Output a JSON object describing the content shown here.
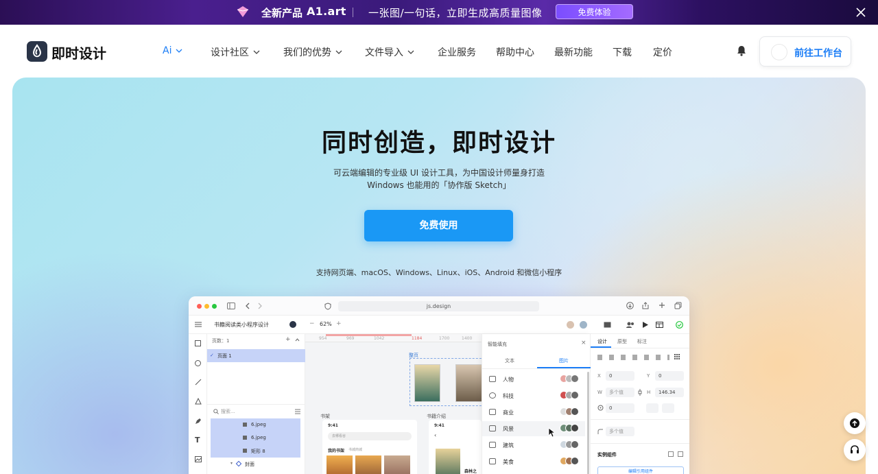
{
  "promo": {
    "product_label": "全新产品",
    "product_name": "A1.art",
    "tagline": "一张图/一句话，立即生成高质量图像",
    "cta": "免费体验"
  },
  "header": {
    "brand": "即时设计",
    "nav": [
      {
        "label": "Ai",
        "dropdown": true
      },
      {
        "label": "设计社区",
        "dropdown": true
      },
      {
        "label": "我们的优势",
        "dropdown": true
      },
      {
        "label": "文件导入",
        "dropdown": true
      },
      {
        "label": "企业服务",
        "dropdown": false
      },
      {
        "label": "帮助中心",
        "dropdown": false
      },
      {
        "label": "最新功能",
        "dropdown": false
      },
      {
        "label": "下载",
        "dropdown": false
      },
      {
        "label": "定价",
        "dropdown": false
      }
    ],
    "workspace_button": "前往工作台"
  },
  "hero": {
    "title": "同时创造，即时设计",
    "subtitle_line1": "可云端编辑的专业级 UI 设计工具，为中国设计师量身打造",
    "subtitle_line2": "Windows 也能用的「协作版 Sketch」",
    "cta": "免费使用",
    "platforms": "支持网页端、macOS、Windows、Linux、iOS、Android 和微信小程序"
  },
  "app": {
    "url": "js.design",
    "file_name": "书籍阅读类小程序设计",
    "zoom": "62%",
    "pages_header": "页数：1",
    "page_item": "页面 1",
    "search_placeholder": "搜索...",
    "layers": [
      "6.jpeg",
      "6.jpeg",
      "矩形 8",
      "封面"
    ],
    "ruler_ticks": [
      "954",
      "969",
      "1042",
      "1184",
      "1700",
      "1400"
    ],
    "canvas_labels": {
      "frame": "整页",
      "shelf": "书架",
      "intro": "书籍介绍",
      "my_shelf": "我的书架",
      "store": "书城商城",
      "search": "去哪看谷",
      "time": "9:41",
      "book_tag": "森林之"
    },
    "fill_panel": {
      "title": "智能填充",
      "tabs": [
        "文本",
        "图片"
      ],
      "categories": [
        "人物",
        "科技",
        "商业",
        "风景",
        "建筑",
        "美食"
      ]
    },
    "right_panel": {
      "tabs": [
        "设计",
        "原型",
        "标注"
      ],
      "x_label": "X",
      "x_value": "0",
      "y_label": "Y",
      "y_value": "0",
      "w_label": "W",
      "w_value": "多个值",
      "h_label": "H",
      "h_value": "146.34",
      "rotation": "0",
      "radius": "多个值",
      "section": "实例组件",
      "edit_btn": "编辑引用组件"
    }
  },
  "colors": {
    "accent": "#1a98f5",
    "brand_dark": "#2a3447"
  }
}
